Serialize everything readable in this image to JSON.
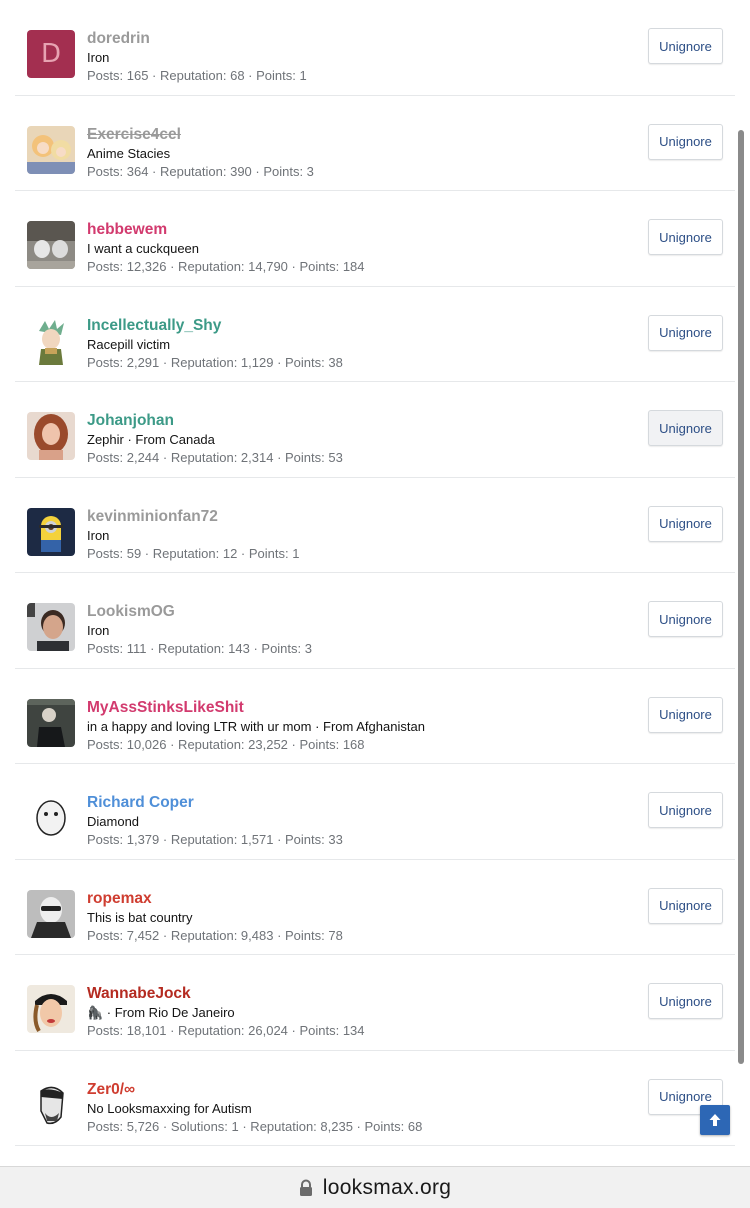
{
  "colors": {
    "iron": "#9a9a9a",
    "pink": "#d23a6e",
    "teal": "#3c9a87",
    "blue": "#4f8fd8",
    "red": "#cf3d30",
    "darkred": "#b42a20",
    "button_text": "#2d4f86",
    "scroll_top_button": "#2d67b5"
  },
  "users": [
    {
      "name": "doredrin",
      "title": "Iron",
      "stats": "Posts: 165 · Reputation: 68 · Points: 1",
      "name_color": "#9a9a9a",
      "avatar": "letter",
      "avatar_letter": "D",
      "avatar_bg": "#a32f50"
    },
    {
      "name": "Exercise4cel",
      "title": "Anime Stacies",
      "stats": "Posts: 364 · Reputation: 390 · Points: 3",
      "name_color": "#9a9a9a",
      "struck": true,
      "avatar": "anime-girls"
    },
    {
      "name": "hebbewem",
      "title": "I want a cuckqueen",
      "stats": "Posts: 12,326 · Reputation: 14,790 · Points: 184",
      "name_color": "#d23a6e",
      "avatar": "statues"
    },
    {
      "name": "Incellectually_Shy",
      "title": "Racepill victim",
      "stats": "Posts: 2,291 · Reputation: 1,129 · Points: 38",
      "name_color": "#3c9a87",
      "avatar": "anime-boy"
    },
    {
      "name": "Johanjohan",
      "title": "Zephir · From Canada",
      "stats": "Posts: 2,244 · Reputation: 2,314 · Points: 53",
      "name_color": "#3c9a87",
      "avatar": "woman-portrait"
    },
    {
      "name": "kevinminionfan72",
      "title": "Iron",
      "stats": "Posts: 59 · Reputation: 12 · Points: 1",
      "name_color": "#9a9a9a",
      "avatar": "minion"
    },
    {
      "name": "LookismOG",
      "title": "Iron",
      "stats": "Posts: 111 · Reputation: 143 · Points: 3",
      "name_color": "#9a9a9a",
      "avatar": "man-portrait"
    },
    {
      "name": "MyAssStinksLikeShit",
      "title": "in a happy and loving LTR with ur mom · From Afghanistan",
      "stats": "Posts: 10,026 · Reputation: 23,252 · Points: 168",
      "name_color": "#d23a6e",
      "avatar": "dark-photo"
    },
    {
      "name": "Richard Coper",
      "title": "Diamond",
      "stats": "Posts: 1,379 · Reputation: 1,571 · Points: 33",
      "name_color": "#4f8fd8",
      "avatar": "cartoon-face"
    },
    {
      "name": "ropemax",
      "title": "This is bat country",
      "stats": "Posts: 7,452 · Reputation: 9,483 · Points: 78",
      "name_color": "#cf3d30",
      "avatar": "bw-portrait"
    },
    {
      "name": "WannabeJock",
      "title": "🦍 · From Rio De Janeiro",
      "stats": "Posts: 18,101 · Reputation: 26,024 · Points: 134",
      "name_color": "#b42a20",
      "avatar": "woman-cap"
    },
    {
      "name": "Zer0/∞",
      "title": "No Looksmaxxing for Autism",
      "stats": "Posts: 5,726 · Solutions: 1 · Reputation: 8,235 · Points: 68",
      "name_color": "#cf3d30",
      "avatar": "sketch-face"
    }
  ],
  "button_label": "Unignore",
  "scroll_top_icon": "arrow-up-icon",
  "scroll_top_glyph": "🡑",
  "browser": {
    "url": "looksmax.org",
    "lock_icon": "lock-icon"
  }
}
